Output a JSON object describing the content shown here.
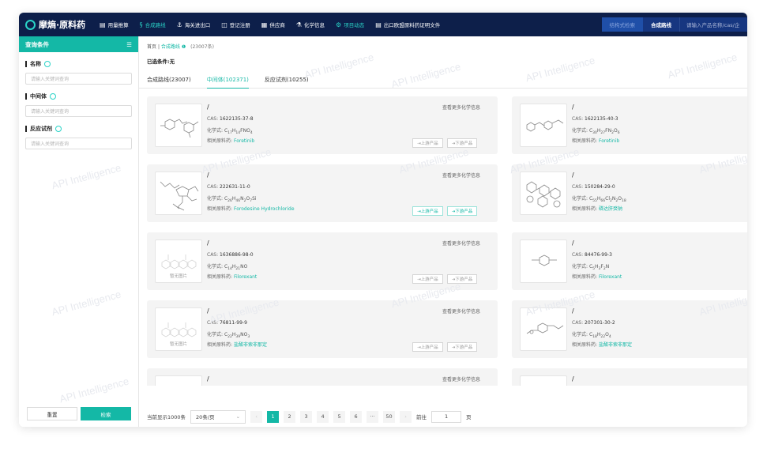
{
  "brand": {
    "name": "摩熵·原料药"
  },
  "nav": [
    {
      "icon": "▤",
      "label": "用量推算"
    },
    {
      "icon": "§",
      "label": "合成路线"
    },
    {
      "icon": "⚓",
      "label": "海关进出口"
    },
    {
      "icon": "◫",
      "label": "登记注册"
    },
    {
      "icon": "▦",
      "label": "供应商"
    },
    {
      "icon": "⚗",
      "label": "化学信息"
    },
    {
      "icon": "⚙",
      "label": "项目动态"
    },
    {
      "icon": "▤",
      "label": "出口欧盟原料药证明文件"
    }
  ],
  "topright": {
    "struct": "结构式检索",
    "route": "合成路线",
    "search_placeholder": "请输入产品名称/cas/企"
  },
  "sidebar": {
    "title": "查询条件",
    "sections": [
      {
        "label": "名称",
        "placeholder": "请输入关键词查询"
      },
      {
        "label": "中间体",
        "placeholder": "请输入关键词查询"
      },
      {
        "label": "反应试剂",
        "placeholder": "请输入关键词查询"
      }
    ],
    "reset": "重置",
    "search": "检索"
  },
  "breadcrumb": {
    "home": "首页",
    "sep": "|",
    "current": "合成路线",
    "count": "(23007条)"
  },
  "selected": "已选条件:无",
  "tabs": [
    "合成路线(23007)",
    "中间体(102371)",
    "反应试剂(10255)"
  ],
  "card_labels": {
    "more": "查看更多化学信息",
    "cas": "CAS:",
    "formula": "化学式:",
    "drug": "相关原料药:",
    "up": "⇥上游产品",
    "down": "⇥下游产品",
    "noimg": "暂无图片"
  },
  "cards": [
    {
      "title": "/",
      "cas": "1622135-37-8",
      "formula": "C<sub>17</sub>H<sub>14</sub>FNO<sub>4</sub>",
      "drug": "Foretinib",
      "buttons": true,
      "up_on": false,
      "down_on": false,
      "img": "a"
    },
    {
      "title": "/",
      "cas": "1622135-40-3",
      "formula": "C<sub>30</sub>H<sub>27</sub>FN<sub>2</sub>O<sub>6</sub>",
      "drug": "Foretinib",
      "buttons": false,
      "img": "b"
    },
    {
      "title": "/",
      "cas": "222631-11-0",
      "formula": "C<sub>26</sub>H<sub>46</sub>N<sub>2</sub>O<sub>7</sub>Si",
      "drug": "Forodesine Hydrochloride",
      "buttons": true,
      "up_on": true,
      "down_on": true,
      "img": "c"
    },
    {
      "title": "/",
      "cas": "150284-29-0",
      "formula": "C<sub>55</sub>H<sub>66</sub>Cl<sub>2</sub>N<sub>2</sub>O<sub>18</sub>",
      "drug": "磷达肝癸钠",
      "buttons": false,
      "img": "d"
    },
    {
      "title": "/",
      "cas": "1636886-98-0",
      "formula": "C<sub>14</sub>H<sub>21</sub>NO",
      "drug": "Filorexant",
      "buttons": true,
      "up_on": false,
      "down_on": false,
      "img": "none"
    },
    {
      "title": "/",
      "cas": "84476-99-3",
      "formula": "C<sub>5</sub>H<sub>3</sub>F<sub>2</sub>N",
      "drug": "Filorexant",
      "buttons": false,
      "img": "e"
    },
    {
      "title": "/",
      "cas": "76811-99-9",
      "formula": "C<sub>22</sub>H<sub>39</sub>NO<sub>3</sub>",
      "drug": "盐酸非索非那定",
      "buttons": true,
      "up_on": false,
      "down_on": false,
      "img": "none"
    },
    {
      "title": "/",
      "cas": "207301-30-2",
      "formula": "C<sub>18</sub>H<sub>22</sub>O<sub>4</sub>",
      "drug": "盐酸非索非那定",
      "buttons": false,
      "img": "f"
    },
    {
      "title": "/",
      "cas": "",
      "formula": "",
      "drug": "",
      "buttons": false,
      "partial": true,
      "img": "none"
    },
    {
      "title": "/",
      "cas": "",
      "formula": "",
      "drug": "",
      "buttons": false,
      "partial": true,
      "img": "b"
    }
  ],
  "pagination": {
    "total": "当前显示1000条",
    "per_page": "20条/页",
    "pages": [
      "1",
      "2",
      "3",
      "4",
      "5",
      "6",
      "···",
      "50"
    ],
    "goto": "前往",
    "goto_value": "1",
    "page_unit": "页",
    "prev": "‹",
    "next": "›"
  },
  "watermark": "API Intelligence"
}
